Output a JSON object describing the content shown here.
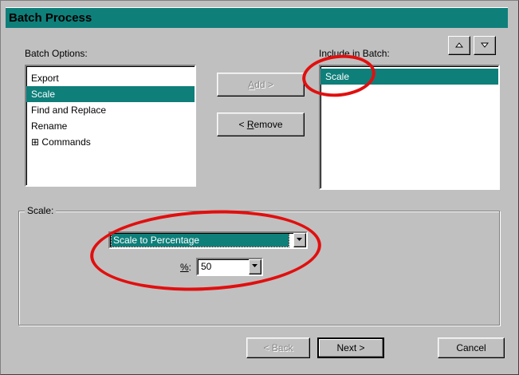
{
  "window": {
    "title": "Batch Process"
  },
  "batch_options": {
    "label": "Batch Options:",
    "items": [
      {
        "label": "Export",
        "selected": false
      },
      {
        "label": "Scale",
        "selected": true
      },
      {
        "label": "Find and Replace",
        "selected": false
      },
      {
        "label": "Rename",
        "selected": false
      },
      {
        "label": "Commands",
        "selected": false,
        "expand_glyph": "⊞"
      }
    ]
  },
  "buttons": {
    "add_label": "Add >",
    "remove_label": "< Remove",
    "back_label": "< Back",
    "next_label": "Next >",
    "cancel_label": "Cancel"
  },
  "include_in_batch": {
    "label": "Include in Batch:",
    "items": [
      {
        "label": "Scale",
        "selected": true
      }
    ]
  },
  "scale_group": {
    "label": "Scale:",
    "mode_value": "Scale to Percentage",
    "percent_label": "%:",
    "percent_value": "50"
  },
  "colors": {
    "highlight": "#0f7f7a",
    "annotation": "#e10f0f",
    "face": "#c0c0c0"
  },
  "icons": [
    "move-up-icon",
    "move-down-icon",
    "chevron-down-icon",
    "expand-plus-icon"
  ]
}
